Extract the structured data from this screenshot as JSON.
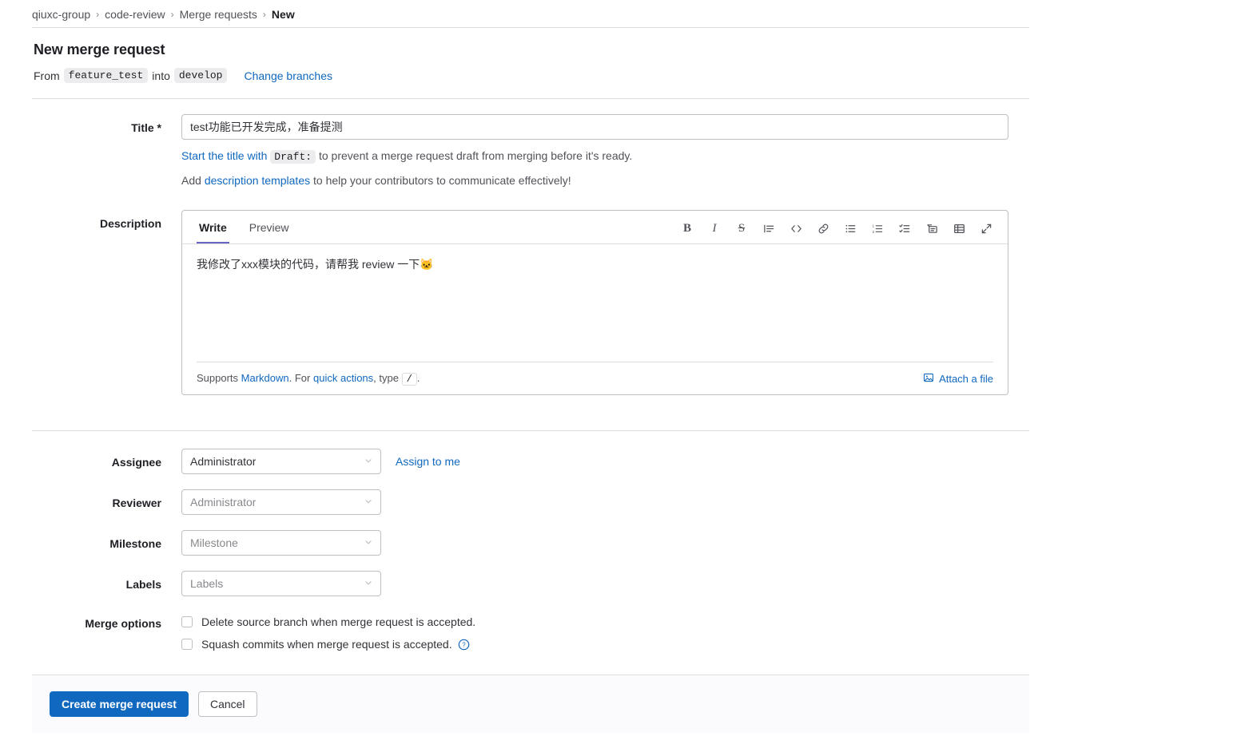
{
  "breadcrumb": {
    "items": [
      {
        "label": "qiuxc-group",
        "current": false
      },
      {
        "label": "code-review",
        "current": false
      },
      {
        "label": "Merge requests",
        "current": false
      },
      {
        "label": "New",
        "current": true
      }
    ],
    "separator": "›"
  },
  "header": {
    "page_title": "New merge request",
    "from_word": "From",
    "source_branch": "feature_test",
    "into_word": "into",
    "target_branch": "develop",
    "change_branches_label": "Change branches"
  },
  "title_field": {
    "label": "Title *",
    "value": "test功能已开发完成，准备提测",
    "placeholder": "",
    "hint1_link": "Start the title with",
    "hint1_code": "Draft:",
    "hint1_rest": "to prevent a merge request draft from merging before it's ready.",
    "hint2_prefix": "Add",
    "hint2_link": "description templates",
    "hint2_rest": "to help your contributors to communicate effectively!"
  },
  "description": {
    "label": "Description",
    "tabs": [
      {
        "label": "Write",
        "active": true
      },
      {
        "label": "Preview",
        "active": false
      }
    ],
    "body_text": "我修改了xxx模块的代码，请帮我 review 一下🐱",
    "toolbar": [
      {
        "name": "bold",
        "glyph": "B"
      },
      {
        "name": "italic",
        "glyph": "I"
      },
      {
        "name": "strikethrough",
        "glyph": "S"
      },
      {
        "name": "quote",
        "glyph": ""
      },
      {
        "name": "code",
        "glyph": "</>"
      },
      {
        "name": "link",
        "glyph": ""
      },
      {
        "name": "bullet-list",
        "glyph": ""
      },
      {
        "name": "numbered-list",
        "glyph": ""
      },
      {
        "name": "task-list",
        "glyph": ""
      },
      {
        "name": "collapsible-section",
        "glyph": ""
      },
      {
        "name": "table",
        "glyph": ""
      },
      {
        "name": "fullscreen",
        "glyph": ""
      }
    ],
    "footer_prefix": "Supports",
    "footer_markdown_link": "Markdown",
    "footer_mid": ". For",
    "footer_quick_actions_link": "quick actions",
    "footer_type": ", type",
    "footer_slash": "/",
    "footer_period": ".",
    "attach_label": "Attach a file"
  },
  "assignee": {
    "label": "Assignee",
    "value": "Administrator",
    "is_placeholder": false,
    "assign_to_me_label": "Assign to me"
  },
  "reviewer": {
    "label": "Reviewer",
    "value": "Administrator",
    "is_placeholder": true
  },
  "milestone": {
    "label": "Milestone",
    "value": "Milestone",
    "is_placeholder": true
  },
  "labels": {
    "label": "Labels",
    "value": "Labels",
    "is_placeholder": true
  },
  "merge_options": {
    "label": "Merge options",
    "delete_source_branch": {
      "text": "Delete source branch when merge request is accepted.",
      "checked": false
    },
    "squash_commits": {
      "text": "Squash commits when merge request is accepted.",
      "checked": false,
      "help_icon": "question-circle-icon"
    }
  },
  "actions": {
    "create_label": "Create merge request",
    "cancel_label": "Cancel"
  },
  "colors": {
    "accent_blue": "#1068bf",
    "link_blue": "#1068bf",
    "tab_underline": "#6666c4",
    "border": "#bfbfc3",
    "divider": "#dcdcde",
    "footer_bg": "#fbfafd",
    "placeholder_text": "#89888d"
  }
}
